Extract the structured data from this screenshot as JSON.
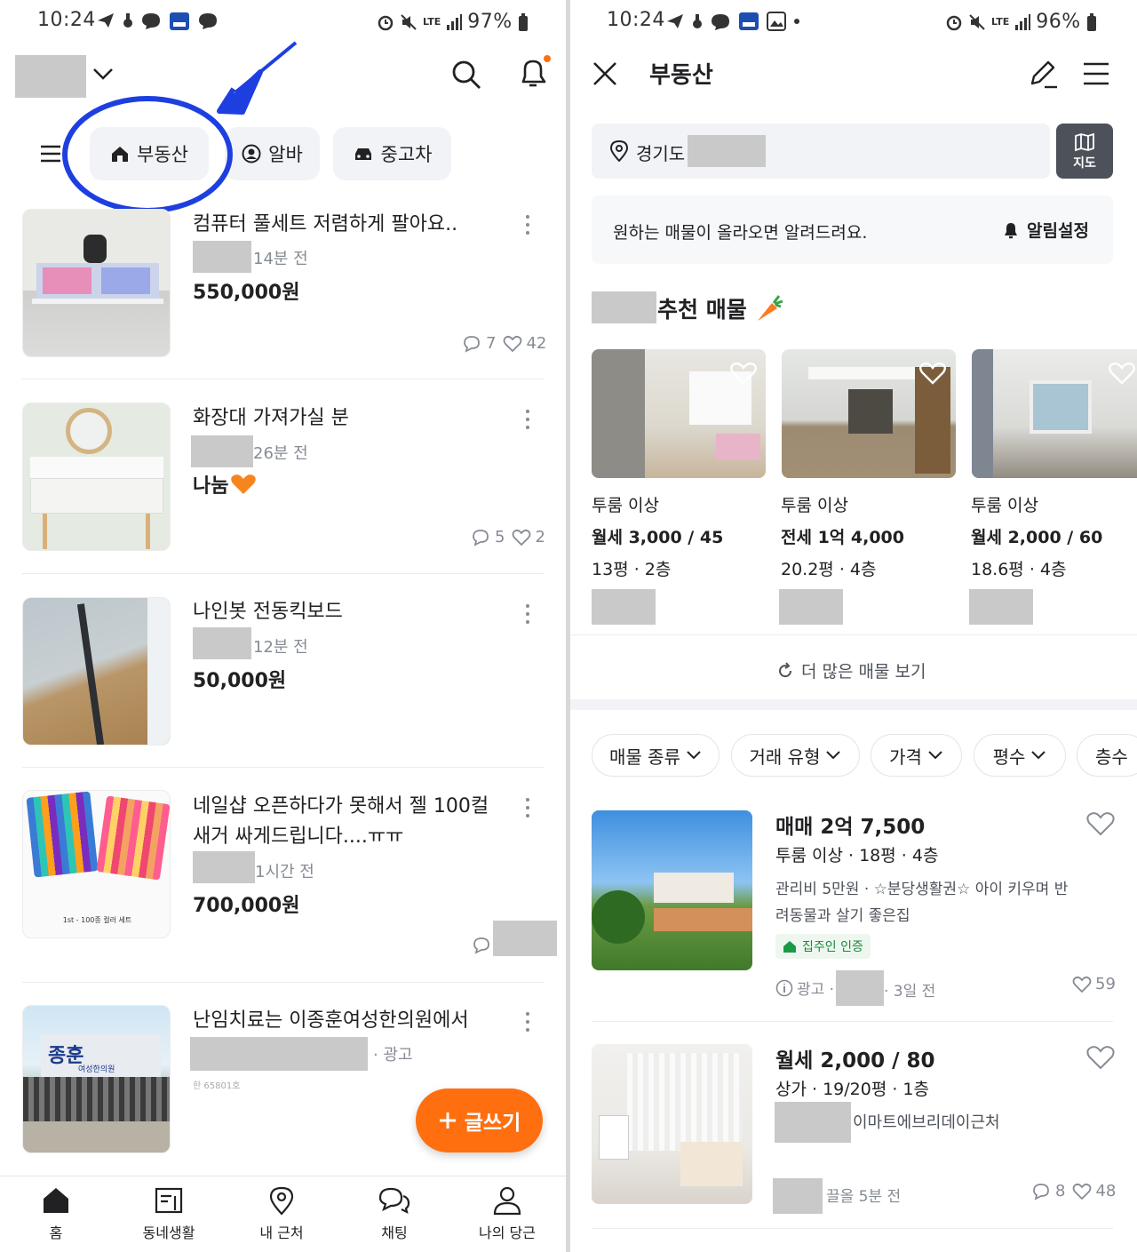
{
  "left": {
    "status": {
      "time": "10:24",
      "battery": "97%",
      "net": "LTE"
    },
    "categories": [
      {
        "label": "부동산",
        "icon": "house-icon"
      },
      {
        "label": "알바",
        "icon": "person-icon"
      },
      {
        "label": "중고차",
        "icon": "car-icon"
      }
    ],
    "items": [
      {
        "title": "컴퓨터 풀세트 저렴하게 팔아요..",
        "time": "14분 전",
        "price": "550,000원",
        "chats": "7",
        "likes": "42"
      },
      {
        "title": "화장대 가져가실 분",
        "time": "26분 전",
        "price": "나눔",
        "chats": "5",
        "likes": "2"
      },
      {
        "title": "나인봇 전동킥보드",
        "time": "12분 전",
        "price": "50,000원"
      },
      {
        "title_line1": "네일샵 오픈하다가 못해서 젤 100컬",
        "title_line2": "새거 싸게드립니다....ㅠㅠ",
        "time": "1시간 전",
        "price": "700,000원",
        "thumb_caption": "1st - 100종 컬러 세트"
      },
      {
        "title": "난임치료는 이종훈여성한의원에서",
        "ad": "· 광고",
        "small": "한 65801호",
        "sign": "종훈",
        "sign_sub": "여성한의원"
      }
    ],
    "fab": {
      "label": "글쓰기"
    },
    "nav": [
      {
        "label": "홈"
      },
      {
        "label": "동네생활"
      },
      {
        "label": "내 근처"
      },
      {
        "label": "채팅"
      },
      {
        "label": "나의 당근"
      }
    ]
  },
  "right": {
    "status": {
      "time": "10:24",
      "battery": "96%",
      "net": "LTE"
    },
    "header": {
      "title": "부동산"
    },
    "search": {
      "location": "경기도",
      "map_label": "지도"
    },
    "alert": {
      "text": "원하는 매물이 올라오면 알려드려요.",
      "action": "알림설정"
    },
    "section_title": "추천 매물",
    "recs": [
      {
        "type": "투룸 이상",
        "price": "월세 3,000 / 45",
        "size": "13평 · 2층"
      },
      {
        "type": "투룸 이상",
        "price": "전세 1억 4,000",
        "size": "20.2평 · 4층"
      },
      {
        "type": "투룸 이상",
        "price": "월세 2,000 / 60",
        "size": "18.6평 · 4층"
      }
    ],
    "more": "더 많은 매물 보기",
    "filters": [
      "매물 종류",
      "거래 유형",
      "가격",
      "평수",
      "층수"
    ],
    "listings": [
      {
        "price": "매매 2억 7,500",
        "spec": "투룸 이상 · 18평 · 4층",
        "desc1": "관리비 5만원 · ☆분당생활권☆ 아이 키우며 반",
        "desc2": "려동물과 살기 좋은집",
        "badge": "집주인 인증",
        "ad": "광고 ·",
        "time": "· 3일 전",
        "likes": "59"
      },
      {
        "price": "월세 2,000 / 80",
        "spec": "상가 · 19/20평 · 1층",
        "desc1": "이마트에브리데이근처",
        "time": "끌올 5분 전",
        "chats": "8",
        "likes": "48"
      }
    ]
  }
}
